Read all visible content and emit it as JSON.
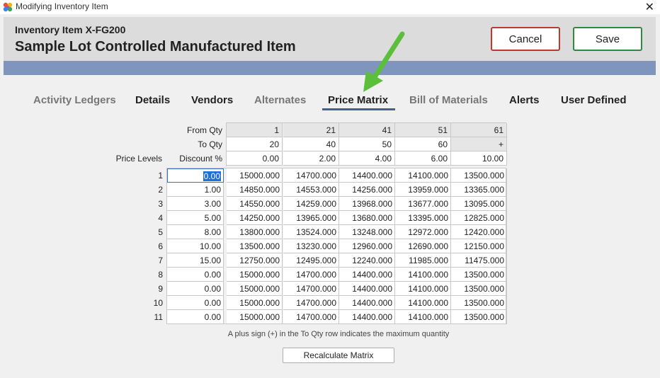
{
  "window": {
    "title": "Modifying Inventory Item",
    "close_glyph": "✕"
  },
  "header": {
    "subtitle": "Inventory Item X-FG200",
    "title": "Sample Lot Controlled Manufactured Item",
    "cancel_label": "Cancel",
    "save_label": "Save"
  },
  "tabs": [
    {
      "label": "Activity Ledgers"
    },
    {
      "label": "Details"
    },
    {
      "label": "Vendors"
    },
    {
      "label": "Alternates"
    },
    {
      "label": "Price Matrix"
    },
    {
      "label": "Bill of Materials"
    },
    {
      "label": "Alerts"
    },
    {
      "label": "User Defined"
    }
  ],
  "matrix": {
    "labels": {
      "from_qty": "From Qty",
      "to_qty": "To Qty",
      "price_levels": "Price Levels",
      "discount": "Discount %"
    },
    "from_qty": [
      "1",
      "21",
      "41",
      "51",
      "61"
    ],
    "to_qty": [
      "20",
      "40",
      "50",
      "60",
      "+"
    ],
    "discount_pct": [
      "0.00",
      "2.00",
      "4.00",
      "6.00",
      "10.00"
    ],
    "rows": [
      {
        "level": "1",
        "discount": "0.00",
        "prices": [
          "15000.000",
          "14700.000",
          "14400.000",
          "14100.000",
          "13500.000"
        ]
      },
      {
        "level": "2",
        "discount": "1.00",
        "prices": [
          "14850.000",
          "14553.000",
          "14256.000",
          "13959.000",
          "13365.000"
        ]
      },
      {
        "level": "3",
        "discount": "3.00",
        "prices": [
          "14550.000",
          "14259.000",
          "13968.000",
          "13677.000",
          "13095.000"
        ]
      },
      {
        "level": "4",
        "discount": "5.00",
        "prices": [
          "14250.000",
          "13965.000",
          "13680.000",
          "13395.000",
          "12825.000"
        ]
      },
      {
        "level": "5",
        "discount": "8.00",
        "prices": [
          "13800.000",
          "13524.000",
          "13248.000",
          "12972.000",
          "12420.000"
        ]
      },
      {
        "level": "6",
        "discount": "10.00",
        "prices": [
          "13500.000",
          "13230.000",
          "12960.000",
          "12690.000",
          "12150.000"
        ]
      },
      {
        "level": "7",
        "discount": "15.00",
        "prices": [
          "12750.000",
          "12495.000",
          "12240.000",
          "11985.000",
          "11475.000"
        ]
      },
      {
        "level": "8",
        "discount": "0.00",
        "prices": [
          "15000.000",
          "14700.000",
          "14400.000",
          "14100.000",
          "13500.000"
        ]
      },
      {
        "level": "9",
        "discount": "0.00",
        "prices": [
          "15000.000",
          "14700.000",
          "14400.000",
          "14100.000",
          "13500.000"
        ]
      },
      {
        "level": "10",
        "discount": "0.00",
        "prices": [
          "15000.000",
          "14700.000",
          "14400.000",
          "14100.000",
          "13500.000"
        ]
      },
      {
        "level": "11",
        "discount": "0.00",
        "prices": [
          "15000.000",
          "14700.000",
          "14400.000",
          "14100.000",
          "13500.000"
        ]
      }
    ],
    "footnote": "A plus sign (+) in the To Qty row indicates the maximum quantity",
    "recalc_label": "Recalculate Matrix"
  },
  "colors": {
    "accent_bar": "#7f95bd",
    "cancel_border": "#c0392b",
    "save_border": "#2e8b3a",
    "arrow": "#5cbf3c",
    "selection": "#1e6fd9"
  },
  "icons": {
    "app": "pinwheel-icon",
    "close": "close-icon",
    "annotation": "green-arrow-icon"
  }
}
